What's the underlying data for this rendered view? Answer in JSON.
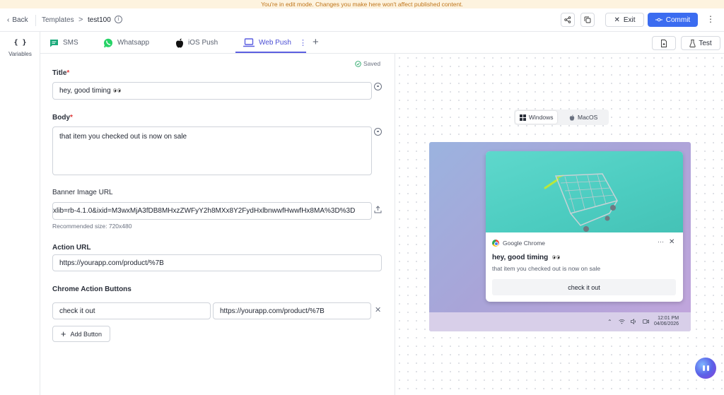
{
  "banner": "You're in edit mode. Changes you make here won't affect published content.",
  "header": {
    "back_label": "Back",
    "breadcrumb": "Templates",
    "separator": ">",
    "current": "test100",
    "exit_label": "Exit",
    "commit_label": "Commit"
  },
  "leftrail": {
    "variables_icon": "{ }",
    "variables_label": "Variables"
  },
  "tabs": [
    {
      "label": "SMS",
      "icon": "sms-icon"
    },
    {
      "label": "Whatsapp",
      "icon": "whatsapp-icon"
    },
    {
      "label": "iOS Push",
      "icon": "apple-icon"
    },
    {
      "label": "Web Push",
      "icon": "laptop-icon",
      "active": true
    }
  ],
  "toolbar": {
    "test_label": "Test"
  },
  "form": {
    "saved_label": "Saved",
    "title_label": "Title",
    "title_value": "hey, good timing",
    "body_label": "Body",
    "body_value": "that item you checked out is now on sale",
    "banner_label": "Banner Image URL",
    "banner_value": "xlib=rb-4.1.0&ixid=M3wxMjA3fDB8MHxzZWFyY2h8MXx8Y2FydHxlbnwwfHwwfHx8MA%3D%3D",
    "banner_hint": "Recommended size: 720x480",
    "action_url_label": "Action URL",
    "action_url_value": "https://yourapp.com/product/%7B",
    "buttons_label": "Chrome Action Buttons",
    "button_text_value": "check it out",
    "button_url_value": "https://yourapp.com/product/%7B",
    "add_button_label": "Add Button",
    "required_mark": "*"
  },
  "preview": {
    "os_windows": "Windows",
    "os_macos": "MacOS",
    "notif_source": "Google Chrome",
    "notif_title": "hey, good timing",
    "notif_body": "that item you checked out is now on sale",
    "notif_action": "check it out",
    "time": "12:01 PM",
    "date": "04/06/2026"
  },
  "colors": {
    "accent": "#3b6cf0",
    "tab_active": "#4b4fd4",
    "banner_bg": "#fdf3df",
    "banner_text": "#c0761c"
  }
}
